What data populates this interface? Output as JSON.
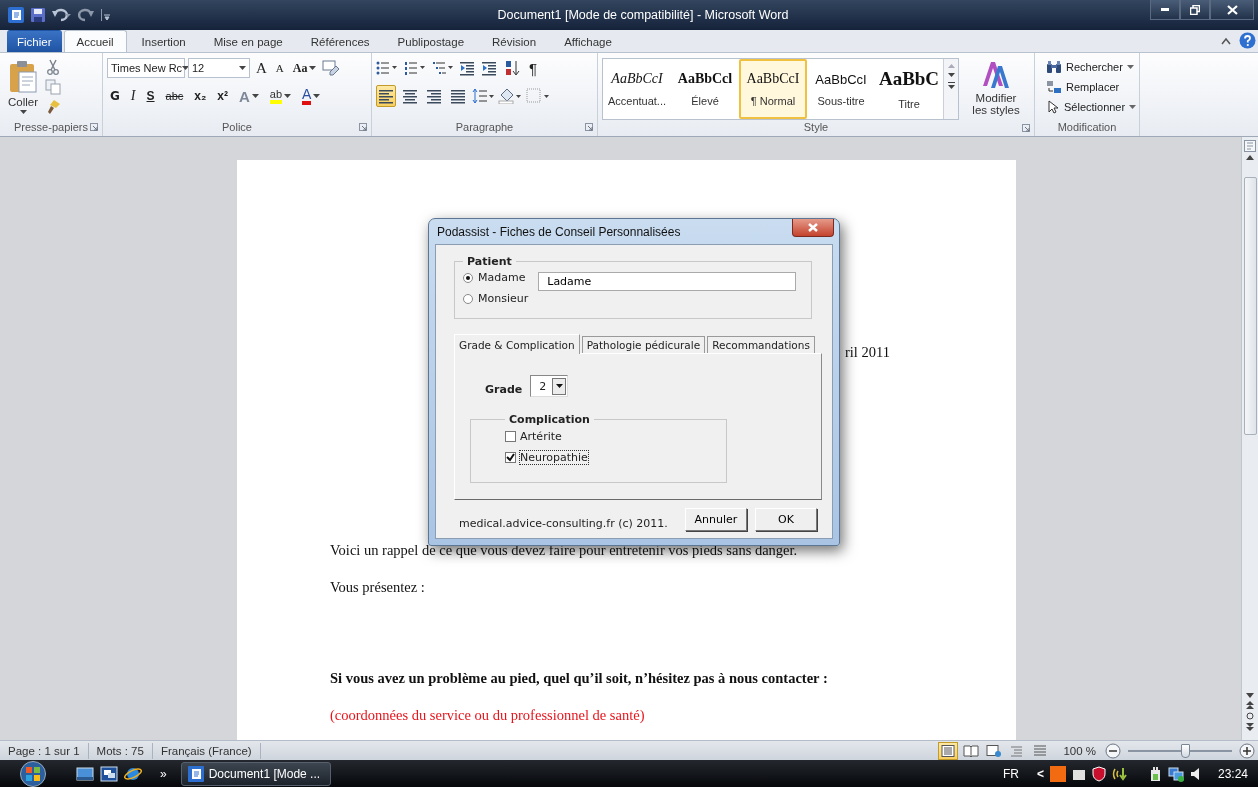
{
  "window": {
    "title": "Document1 [Mode de compatibilité] - Microsoft Word"
  },
  "ribbon_tabs": [
    {
      "label": "Fichier",
      "kind": "file",
      "selected": false
    },
    {
      "label": "Accueil",
      "kind": "tab",
      "selected": true
    },
    {
      "label": "Insertion",
      "kind": "tab",
      "selected": false
    },
    {
      "label": "Mise en page",
      "kind": "tab",
      "selected": false
    },
    {
      "label": "Références",
      "kind": "tab",
      "selected": false
    },
    {
      "label": "Publipostage",
      "kind": "tab",
      "selected": false
    },
    {
      "label": "Révision",
      "kind": "tab",
      "selected": false
    },
    {
      "label": "Affichage",
      "kind": "tab",
      "selected": false
    }
  ],
  "clipboard": {
    "paste_label": "Coller",
    "group_label": "Presse-papiers"
  },
  "font": {
    "name": "Times New Rc",
    "size": "12",
    "grow_label": "A",
    "shrink_label": "A",
    "case_label": "Aa",
    "group_label": "Police",
    "format_buttons": [
      {
        "label": "G",
        "kind": "bold"
      },
      {
        "label": "I",
        "kind": "italic"
      },
      {
        "label": "S",
        "kind": "underline"
      },
      {
        "label": "abc",
        "kind": "strike"
      },
      {
        "label": "x₂",
        "kind": "sub"
      },
      {
        "label": "x²",
        "kind": "sup"
      }
    ],
    "color_buttons": [
      {
        "label": "A",
        "kind": "effects"
      },
      {
        "label": "ab",
        "kind": "highlight"
      },
      {
        "label": "A",
        "kind": "color"
      }
    ]
  },
  "paragraph": {
    "group_label": "Paragraphe",
    "pilcrow": "¶",
    "alignment": [
      {
        "kind": "left",
        "selected": true
      },
      {
        "kind": "center",
        "selected": false
      },
      {
        "kind": "right",
        "selected": false
      },
      {
        "kind": "justify",
        "selected": false
      }
    ]
  },
  "styles": {
    "group_label": "Style",
    "change_label": "Modifier les styles",
    "items": [
      {
        "preview": "AaBbCcI",
        "label": "Accentuat...",
        "kind": "emphasis",
        "selected": false
      },
      {
        "preview": "AaBbCcl",
        "label": "Élevé",
        "kind": "strong",
        "selected": false
      },
      {
        "preview": "AaBbCcI",
        "label": "¶ Normal",
        "kind": "normal",
        "selected": true
      },
      {
        "preview": "AaBbCcI",
        "label": "Sous-titre",
        "kind": "subtitle",
        "selected": false
      },
      {
        "preview": "AaBbC",
        "label": "Titre",
        "kind": "title",
        "selected": false
      }
    ]
  },
  "editing": {
    "group_label": "Modification",
    "items": [
      {
        "label": "Rechercher",
        "kind": "find",
        "dropdown": true
      },
      {
        "label": "Remplacer",
        "kind": "replace",
        "dropdown": false
      },
      {
        "label": "Sélectionner",
        "kind": "select",
        "dropdown": true
      }
    ]
  },
  "document": {
    "date_fragment": "ril 2011",
    "paragraphs": [
      {
        "text": "Voici un rappel de ce que vous devez faire pour entretenir vos pieds sans danger.",
        "kind": "normal"
      },
      {
        "text": "Vous présentez :",
        "kind": "normal"
      },
      {
        "text": "Si vous avez un problème au pied, quel qu’il soit, n’hésitez pas à nous contacter :",
        "kind": "bold"
      },
      {
        "text": "(coordonnées du service  ou du professionnel  de santé)",
        "kind": "red"
      }
    ]
  },
  "dialog": {
    "title": "Podassist - Fiches de Conseil Personnalisées",
    "patient": {
      "legend": "Patient",
      "name": "Ladame",
      "salutations": [
        {
          "label": "Madame",
          "selected": true
        },
        {
          "label": "Monsieur",
          "selected": false
        }
      ]
    },
    "tabs": [
      {
        "label": "Grade & Complication",
        "selected": true
      },
      {
        "label": "Pathologie pédicurale",
        "selected": false
      },
      {
        "label": "Recommandations",
        "selected": false
      }
    ],
    "grade": {
      "label": "Grade",
      "value": "2"
    },
    "complication": {
      "legend": "Complication",
      "items": [
        {
          "label": "Artérite",
          "checked": false,
          "focused": false
        },
        {
          "label": "Neuropathie",
          "checked": true,
          "focused": true
        }
      ]
    },
    "footer": "medical.advice-consulting.fr (c) 2011.",
    "buttons": [
      "Annuler",
      "OK"
    ]
  },
  "status_bar": {
    "items": [
      "Page : 1 sur 1",
      "Mots : 75",
      "Français (France)"
    ],
    "views": [
      {
        "kind": "print",
        "selected": true
      },
      {
        "kind": "reading",
        "selected": false
      },
      {
        "kind": "web",
        "selected": false
      },
      {
        "kind": "outline",
        "selected": false
      },
      {
        "kind": "draft",
        "selected": false
      }
    ],
    "zoom": {
      "reading": "100 %",
      "level": 0.55
    }
  },
  "taskbar": {
    "more": "»",
    "task": "Document1 [Mode ...",
    "language": "FR",
    "tray_arrow": "<",
    "clock": "23:24"
  }
}
